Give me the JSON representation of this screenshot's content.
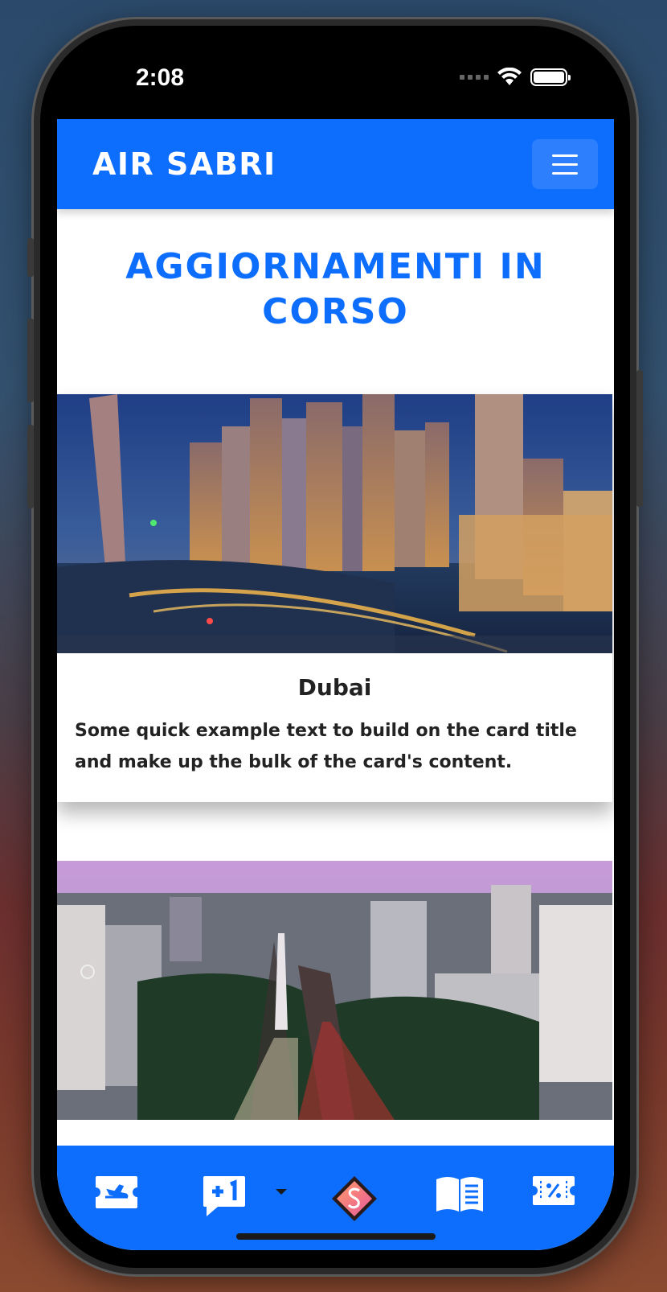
{
  "status": {
    "time": "2:08"
  },
  "navbar": {
    "brand": "AIR SABRI"
  },
  "page": {
    "title": "AGGIORNAMENTI IN CORSO"
  },
  "cards": [
    {
      "title": "Dubai",
      "text": "Some quick example text to build on the card title and make up the bulk of the card's content."
    },
    {
      "title": "",
      "text": ""
    }
  ],
  "tabbar": {
    "items": [
      {
        "icon": "ticket-plane-icon"
      },
      {
        "icon": "message-plus-one-icon"
      },
      {
        "icon": "diamond-logo-icon"
      },
      {
        "icon": "open-book-icon"
      },
      {
        "icon": "discount-ticket-icon"
      }
    ]
  },
  "colors": {
    "primary": "#0d6efd",
    "title": "#0d6efd"
  }
}
